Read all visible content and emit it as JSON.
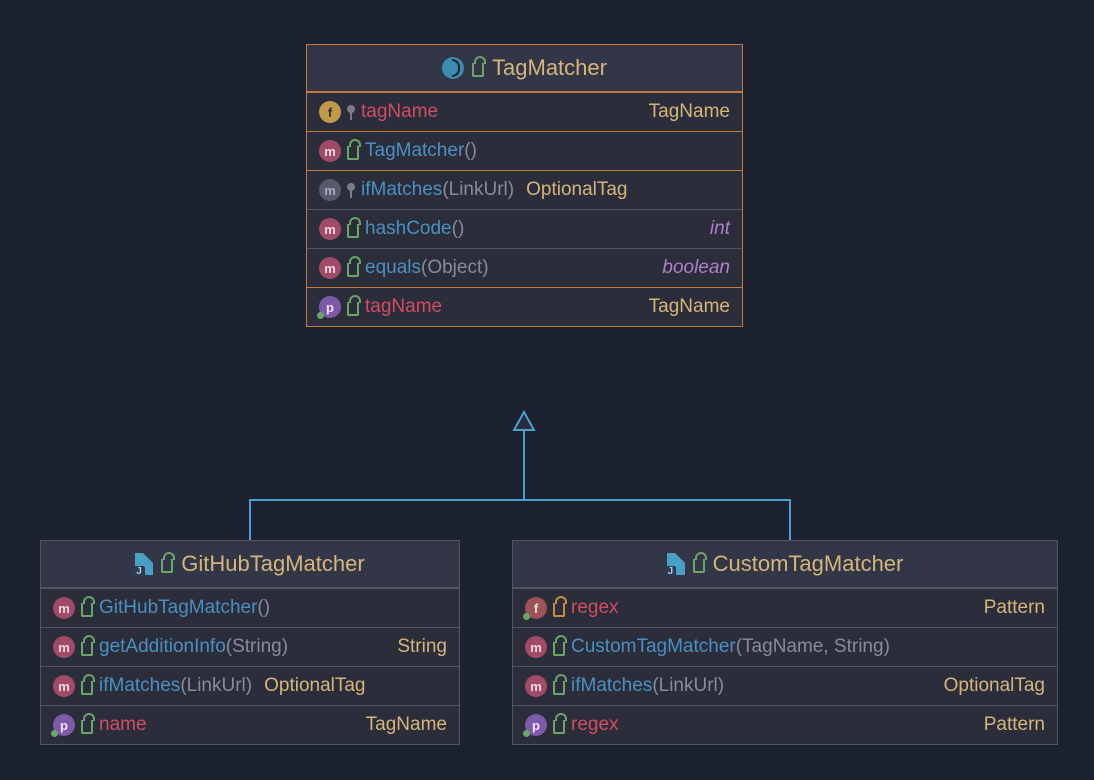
{
  "classes": {
    "tagMatcher": {
      "title": "TagMatcher",
      "members": [
        {
          "badge": "f",
          "name": "tagName",
          "nameKind": "field",
          "pin": true,
          "type": "TagName"
        },
        {
          "badge": "m",
          "name": "TagMatcher",
          "nameKind": "method",
          "suffix": "()",
          "section": true
        },
        {
          "badge": "md",
          "name": "ifMatches",
          "nameKind": "method",
          "suffix": "(LinkUrl)",
          "pin": true,
          "type": "OptionalTag",
          "section": true
        },
        {
          "badge": "m",
          "name": "hashCode",
          "nameKind": "method",
          "suffix": "()",
          "typeItalic": "int"
        },
        {
          "badge": "m",
          "name": "equals",
          "nameKind": "method",
          "suffix": "(Object)",
          "typeItalic": "boolean"
        },
        {
          "badge": "p",
          "name": "tagName",
          "nameKind": "field",
          "greendot": true,
          "type": "TagName",
          "section": true
        }
      ]
    },
    "github": {
      "title": "GitHubTagMatcher",
      "members": [
        {
          "badge": "m",
          "name": "GitHubTagMatcher",
          "nameKind": "method",
          "suffix": "()"
        },
        {
          "badge": "m",
          "name": "getAdditionInfo",
          "nameKind": "method",
          "suffix": "(String)",
          "type": "String"
        },
        {
          "badge": "m",
          "name": "ifMatches",
          "nameKind": "method",
          "suffix": "(LinkUrl)",
          "type": "OptionalTag"
        },
        {
          "badge": "p",
          "name": "name",
          "nameKind": "field",
          "greendot": true,
          "type": "TagName",
          "section": true
        }
      ]
    },
    "custom": {
      "title": "CustomTagMatcher",
      "members": [
        {
          "badge": "ff",
          "name": "regex",
          "nameKind": "field",
          "lockOrange": true,
          "greendot": true,
          "type": "Pattern"
        },
        {
          "badge": "m",
          "name": "CustomTagMatcher",
          "nameKind": "method",
          "suffix": "(TagName, String)",
          "section": true
        },
        {
          "badge": "m",
          "name": "ifMatches",
          "nameKind": "method",
          "suffix": "(LinkUrl)",
          "type": "OptionalTag"
        },
        {
          "badge": "p",
          "name": "regex",
          "nameKind": "field",
          "greendot": true,
          "type": "Pattern",
          "section": true
        }
      ]
    }
  }
}
